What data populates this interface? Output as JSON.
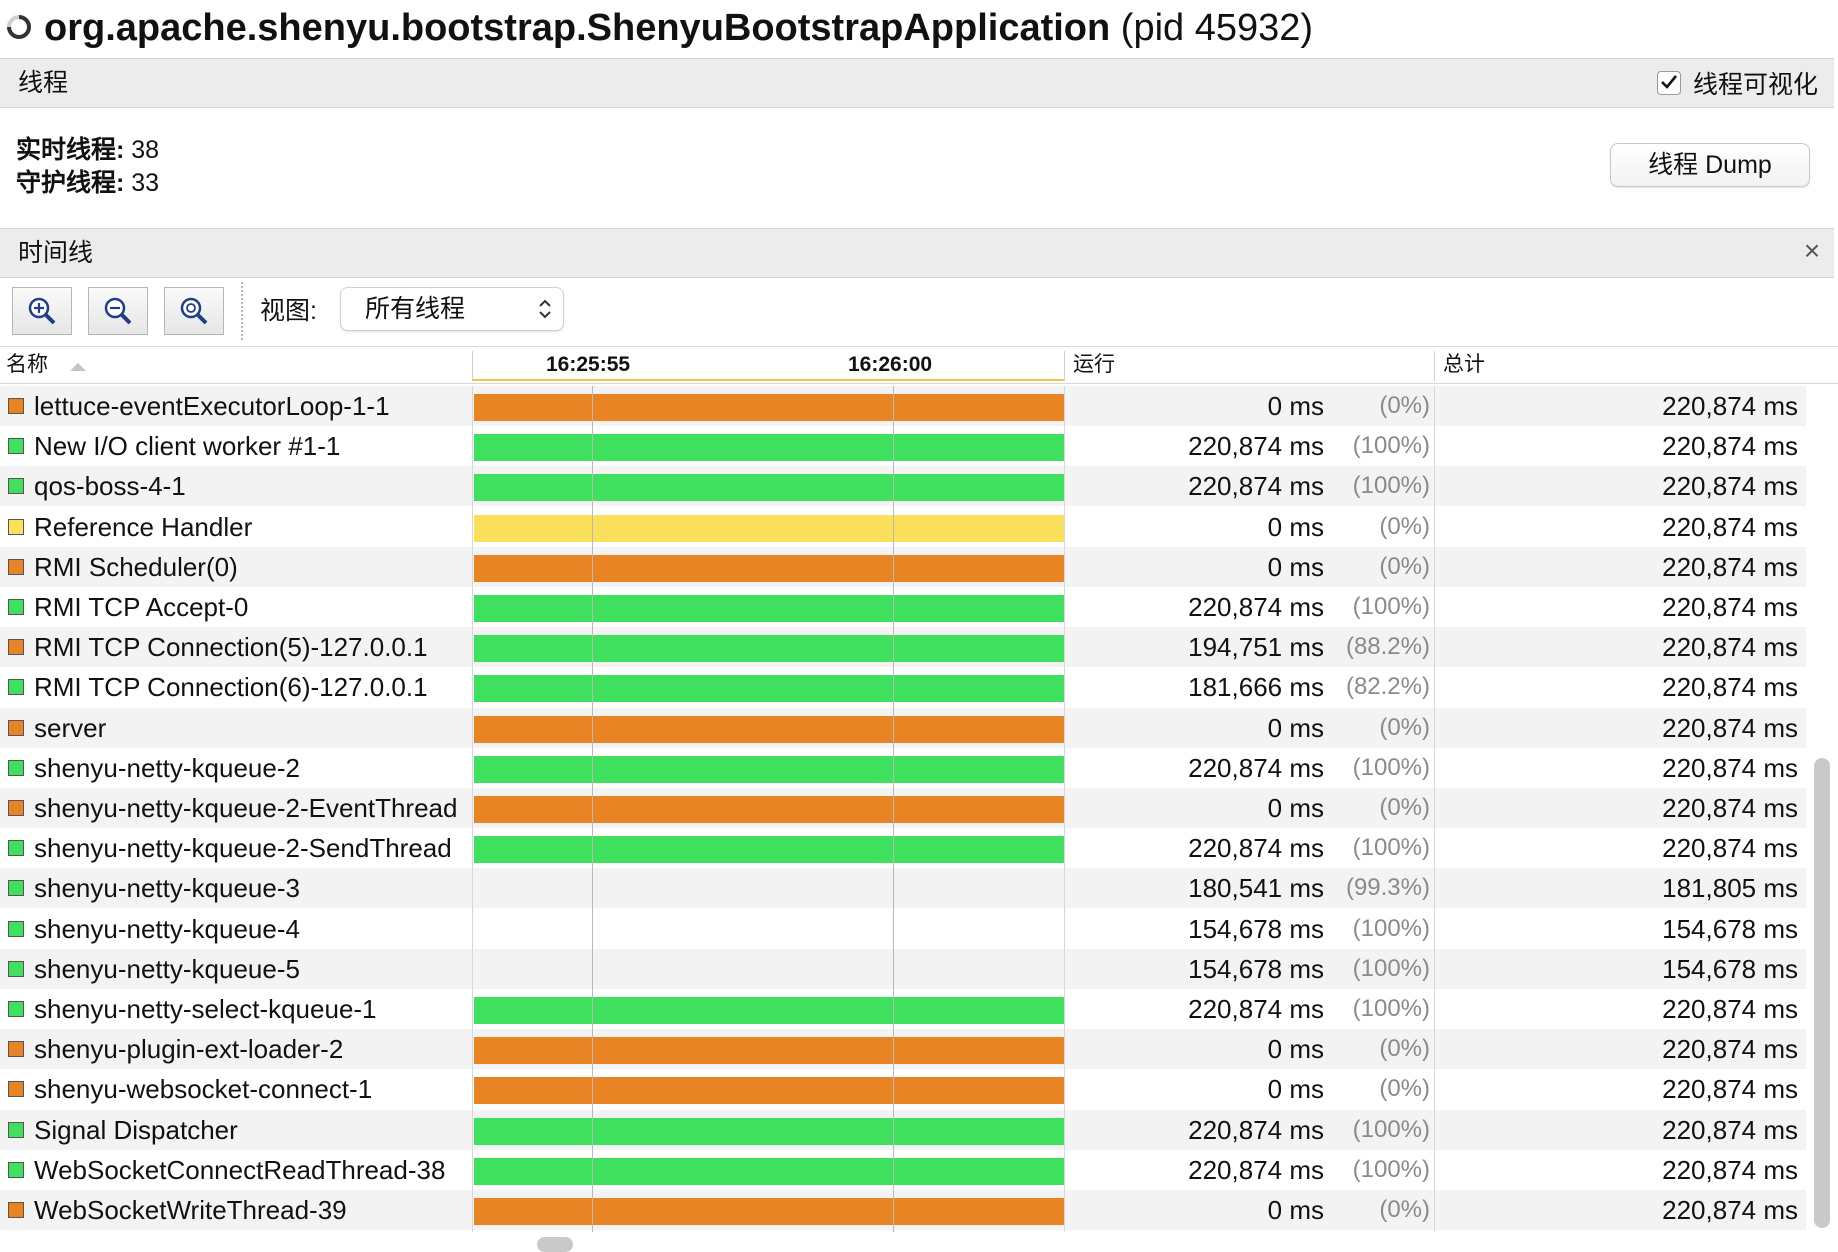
{
  "header": {
    "app_name": "org.apache.shenyu.bootstrap.ShenyuBootstrapApplication",
    "pid": "(pid 45932)"
  },
  "threads_section": {
    "title": "线程",
    "visualize_label": "线程可视化",
    "visualize_checked": true,
    "live_label": "实时线程:",
    "live_value": "38",
    "daemon_label": "守护线程:",
    "daemon_value": "33",
    "dump_button": "线程 Dump"
  },
  "timeline_section": {
    "title": "时间线",
    "close_icon": "close-icon",
    "toolbar": {
      "zoom_in_icon": "zoom-in-icon",
      "zoom_out_icon": "zoom-out-icon",
      "zoom_fit_icon": "zoom-fit-icon"
    },
    "view_label": "视图:",
    "view_selected": "所有线程"
  },
  "columns": {
    "name": "名称",
    "time_1": "16:25:55",
    "time_2": "16:26:00",
    "running": "运行",
    "total": "总计"
  },
  "colors": {
    "running": "#3ee05e",
    "waiting": "#e98424",
    "monitor": "#fbe05c"
  },
  "threads": [
    {
      "name": "lettuce-eventExecutorLoop-1-1",
      "state": "waiting",
      "bar": true,
      "run": "0 ms",
      "pct": "(0%)",
      "total": "220,874 ms"
    },
    {
      "name": "New I/O client worker #1-1",
      "state": "running",
      "bar": true,
      "run": "220,874 ms",
      "pct": "(100%)",
      "total": "220,874 ms"
    },
    {
      "name": "qos-boss-4-1",
      "state": "running",
      "bar": true,
      "run": "220,874 ms",
      "pct": "(100%)",
      "total": "220,874 ms"
    },
    {
      "name": "Reference Handler",
      "state": "monitor",
      "bar": true,
      "run": "0 ms",
      "pct": "(0%)",
      "total": "220,874 ms"
    },
    {
      "name": "RMI Scheduler(0)",
      "state": "waiting",
      "bar": true,
      "run": "0 ms",
      "pct": "(0%)",
      "total": "220,874 ms"
    },
    {
      "name": "RMI TCP Accept-0",
      "state": "running",
      "bar": true,
      "run": "220,874 ms",
      "pct": "(100%)",
      "total": "220,874 ms"
    },
    {
      "name": "RMI TCP Connection(5)-127.0.0.1",
      "state": "waiting",
      "bar_state": "running",
      "bar": true,
      "run": "194,751 ms",
      "pct": "(88.2%)",
      "total": "220,874 ms"
    },
    {
      "name": "RMI TCP Connection(6)-127.0.0.1",
      "state": "running",
      "bar": true,
      "run": "181,666 ms",
      "pct": "(82.2%)",
      "total": "220,874 ms"
    },
    {
      "name": "server",
      "state": "waiting",
      "bar": true,
      "run": "0 ms",
      "pct": "(0%)",
      "total": "220,874 ms"
    },
    {
      "name": "shenyu-netty-kqueue-2",
      "state": "running",
      "bar": true,
      "run": "220,874 ms",
      "pct": "(100%)",
      "total": "220,874 ms"
    },
    {
      "name": "shenyu-netty-kqueue-2-EventThread",
      "state": "waiting",
      "bar": true,
      "run": "0 ms",
      "pct": "(0%)",
      "total": "220,874 ms"
    },
    {
      "name": "shenyu-netty-kqueue-2-SendThread",
      "state": "running",
      "bar": true,
      "run": "220,874 ms",
      "pct": "(100%)",
      "total": "220,874 ms"
    },
    {
      "name": "shenyu-netty-kqueue-3",
      "state": "running",
      "bar": false,
      "run": "180,541 ms",
      "pct": "(99.3%)",
      "total": "181,805 ms"
    },
    {
      "name": "shenyu-netty-kqueue-4",
      "state": "running",
      "bar": false,
      "run": "154,678 ms",
      "pct": "(100%)",
      "total": "154,678 ms"
    },
    {
      "name": "shenyu-netty-kqueue-5",
      "state": "running",
      "bar": false,
      "run": "154,678 ms",
      "pct": "(100%)",
      "total": "154,678 ms"
    },
    {
      "name": "shenyu-netty-select-kqueue-1",
      "state": "running",
      "bar": true,
      "run": "220,874 ms",
      "pct": "(100%)",
      "total": "220,874 ms"
    },
    {
      "name": "shenyu-plugin-ext-loader-2",
      "state": "waiting",
      "bar": true,
      "run": "0 ms",
      "pct": "(0%)",
      "total": "220,874 ms"
    },
    {
      "name": "shenyu-websocket-connect-1",
      "state": "waiting",
      "bar": true,
      "run": "0 ms",
      "pct": "(0%)",
      "total": "220,874 ms"
    },
    {
      "name": "Signal Dispatcher",
      "state": "running",
      "bar": true,
      "run": "220,874 ms",
      "pct": "(100%)",
      "total": "220,874 ms"
    },
    {
      "name": "WebSocketConnectReadThread-38",
      "state": "running",
      "bar": true,
      "run": "220,874 ms",
      "pct": "(100%)",
      "total": "220,874 ms"
    },
    {
      "name": "WebSocketWriteThread-39",
      "state": "waiting",
      "bar": true,
      "run": "0 ms",
      "pct": "(0%)",
      "total": "220,874 ms"
    }
  ]
}
